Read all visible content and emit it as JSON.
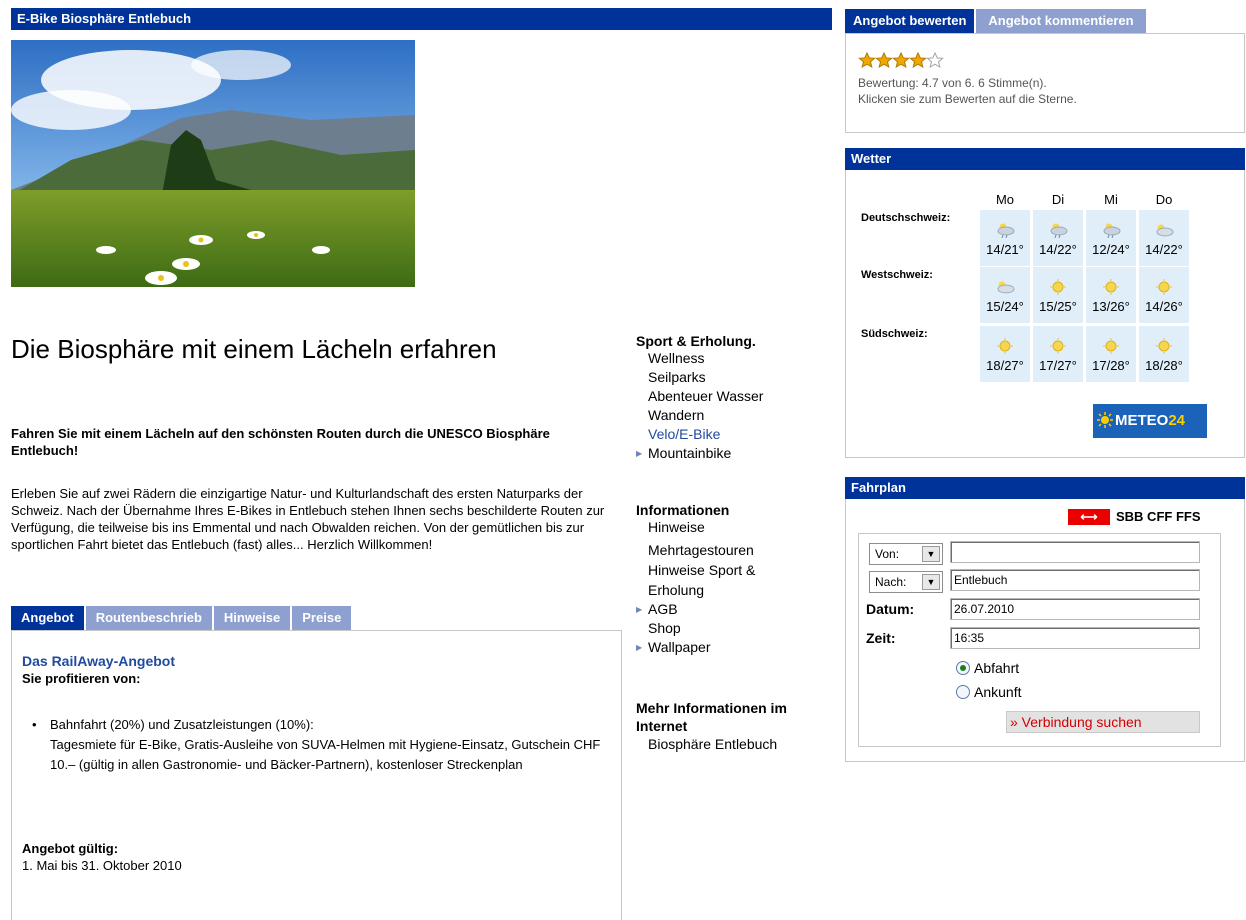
{
  "header": {
    "title": "E-Bike Biosphäre Entlebuch"
  },
  "hero": {
    "alt": "meadow-with-daisies-and-mountains"
  },
  "main": {
    "heading": "Die Biosphäre mit einem Lächeln erfahren",
    "lead": "Fahren Sie mit einem Lächeln auf den schönsten Routen durch die UNESCO Biosphäre Entlebuch!",
    "body": "Erleben Sie auf zwei Rädern die einzigartige Natur- und Kulturlandschaft des ersten Naturparks der Schweiz. Nach der Übernahme Ihres E-Bikes in Entlebuch stehen Ihnen sechs beschilderte Routen zur Verfügung, die teilweise bis ins Emmental und nach Obwalden reichen. Von der gemütlichen bis zur sportlichen Fahrt bietet das Entlebuch (fast) alles... Herzlich Willkommen!",
    "tabs": [
      {
        "label": "Angebot"
      },
      {
        "label": "Routenbeschrieb"
      },
      {
        "label": "Hinweise"
      },
      {
        "label": "Preise"
      }
    ],
    "offer": {
      "title": "Das RailAway-Angebot",
      "subtitle": "Sie profitieren von:",
      "bullet_line1": "Bahnfahrt (20%) und Zusatzleistungen (10%):",
      "bullet_line2": "Tagesmiete für E-Bike, Gratis-Ausleihe von SUVA-Helmen mit Hygiene-Einsatz, Gutschein CHF 10.– (gültig in allen Gastronomie- und Bäcker-Partnern), kostenloser Streckenplan",
      "valid_label": "Angebot gültig:",
      "valid_value": "1. Mai bis 31. Oktober 2010"
    }
  },
  "nav": {
    "sport": {
      "heading": "Sport & Erholung.",
      "items": [
        {
          "label": "Wellness"
        },
        {
          "label": "Seilparks"
        },
        {
          "label": "Abenteuer Wasser"
        },
        {
          "label": "Wandern"
        },
        {
          "label": "Velo/E-Bike"
        },
        {
          "label": "Mountainbike"
        }
      ]
    },
    "info": {
      "heading": "Informationen",
      "items": [
        {
          "label": "Hinweise"
        },
        {
          "label": "Mehrtagestouren"
        },
        {
          "label": "Hinweise Sport & Erholung"
        },
        {
          "label": "AGB"
        },
        {
          "label": "Shop"
        },
        {
          "label": "Wallpaper"
        }
      ]
    },
    "more": {
      "heading": "Mehr Informationen im Internet",
      "items": [
        {
          "label": "Biosphäre Entlebuch"
        }
      ]
    }
  },
  "rating": {
    "tabs": [
      {
        "label": "Angebot bewerten"
      },
      {
        "label": "Angebot kommentieren"
      }
    ],
    "stars_filled": 4.7,
    "stars_total": 5,
    "text": "Bewertung: 4.7 von 6. 6 Stimme(n).",
    "hint": "Klicken sie zum Bewerten auf die Sterne."
  },
  "weather": {
    "title": "Wetter",
    "days": [
      "Mo",
      "Di",
      "Mi",
      "Do"
    ],
    "regions": [
      {
        "name": "Deutschschweiz:",
        "icons": [
          "rain-cloud-icon",
          "rain-cloud-icon",
          "rain-cloud-icon",
          "cloud-icon"
        ],
        "temps": [
          "14/21°",
          "14/22°",
          "12/24°",
          "14/22°"
        ]
      },
      {
        "name": "Westschweiz:",
        "icons": [
          "cloud-icon",
          "sun-icon",
          "sun-icon",
          "sun-icon"
        ],
        "temps": [
          "15/24°",
          "15/25°",
          "13/26°",
          "14/26°"
        ]
      },
      {
        "name": "Südschweiz:",
        "icons": [
          "sun-icon",
          "sun-icon",
          "sun-icon",
          "sun-icon"
        ],
        "temps": [
          "18/27°",
          "17/27°",
          "17/28°",
          "18/28°"
        ]
      }
    ],
    "logo_part1": "METEO",
    "logo_part2": "24"
  },
  "timetable": {
    "title": "Fahrplan",
    "brand": "SBB CFF FFS",
    "from_label": "Von:",
    "from_value": "",
    "to_label": "Nach:",
    "to_value": "Entlebuch",
    "date_label": "Datum:",
    "date_value": "26.07.2010",
    "time_label": "Zeit:",
    "time_value": "16:35",
    "radio_departure": "Abfahrt",
    "radio_arrival": "Ankunft",
    "search_button": "» Verbindung suchen"
  },
  "colors": {
    "brand_blue": "#003399",
    "tab_inactive": "#8ea0cf",
    "link_blue": "#1f4a9e",
    "sbb_red": "#eb0000",
    "meteo_yellow": "#ffcc00"
  }
}
